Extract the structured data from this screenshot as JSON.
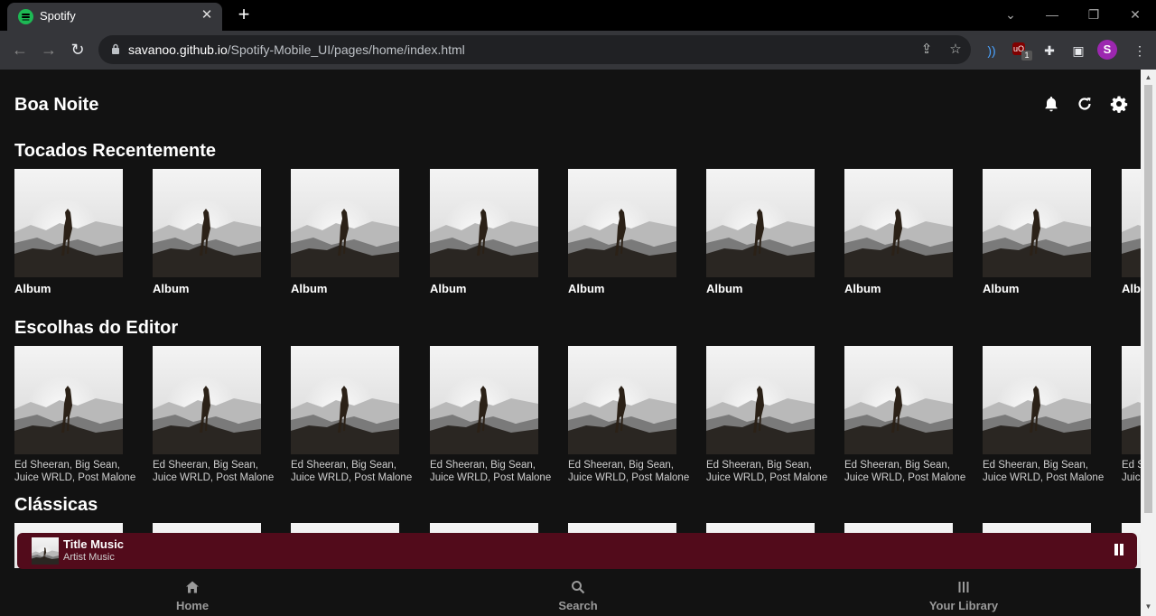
{
  "browser": {
    "tab_title": "Spotify",
    "url_host": "savanoo.github.io",
    "url_path": "/Spotify-Mobile_UI/pages/home/index.html",
    "ext_badge": "1",
    "profile_initial": "S"
  },
  "page": {
    "greeting": "Boa Noite",
    "header_icons": [
      "bell-icon",
      "refresh-icon",
      "gear-icon"
    ],
    "sections": [
      {
        "title": "Tocados Recentemente",
        "cards": [
          {
            "label": "Album"
          },
          {
            "label": "Album"
          },
          {
            "label": "Album"
          },
          {
            "label": "Album"
          },
          {
            "label": "Album"
          },
          {
            "label": "Album"
          },
          {
            "label": "Album"
          },
          {
            "label": "Album"
          },
          {
            "label": "Album"
          }
        ]
      },
      {
        "title": "Escolhas do Editor",
        "cards": [
          {
            "line1": "Ed Sheeran, Big Sean,",
            "line2": "Juice WRLD, Post Malone"
          },
          {
            "line1": "Ed Sheeran, Big Sean,",
            "line2": "Juice WRLD, Post Malone"
          },
          {
            "line1": "Ed Sheeran, Big Sean,",
            "line2": "Juice WRLD, Post Malone"
          },
          {
            "line1": "Ed Sheeran, Big Sean,",
            "line2": "Juice WRLD, Post Malone"
          },
          {
            "line1": "Ed Sheeran, Big Sean,",
            "line2": "Juice WRLD, Post Malone"
          },
          {
            "line1": "Ed Sheeran, Big Sean,",
            "line2": "Juice WRLD, Post Malone"
          },
          {
            "line1": "Ed Sheeran, Big Sean,",
            "line2": "Juice WRLD, Post Malone"
          },
          {
            "line1": "Ed Sheeran, Big Sean,",
            "line2": "Juice WRLD, Post Malone"
          },
          {
            "line1": "Ed Sheeran, Big Sean,",
            "line2": "Juice WRLD, Post Malone"
          }
        ]
      },
      {
        "title": "Clássicas"
      }
    ]
  },
  "player": {
    "title": "Title Music",
    "artist": "Artist Music"
  },
  "bottom_nav": [
    {
      "label": "Home",
      "icon": "home-icon"
    },
    {
      "label": "Search",
      "icon": "search-icon"
    },
    {
      "label": "Your Library",
      "icon": "library-icon"
    }
  ],
  "colors": {
    "background": "#121212",
    "player_bg": "#520b1b",
    "spotify_green": "#1db954"
  }
}
